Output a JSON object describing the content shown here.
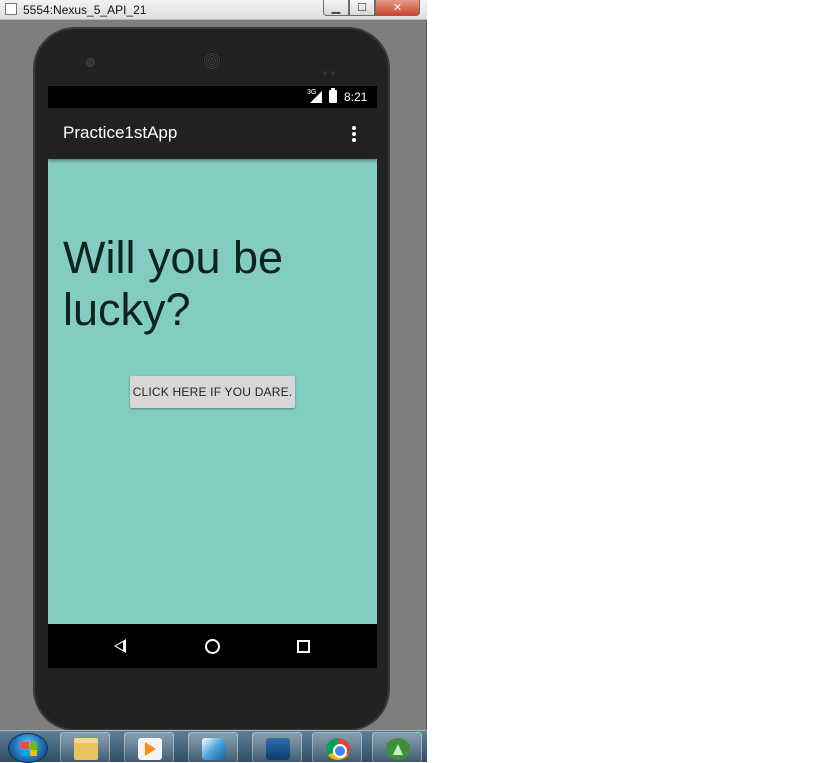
{
  "window": {
    "title": "5554:Nexus_5_API_21",
    "minimize_glyph": "▁",
    "maximize_glyph": "☐",
    "close_glyph": "✕"
  },
  "statusbar": {
    "network": "3G",
    "time": "8:21"
  },
  "actionbar": {
    "title": "Practice1stApp",
    "overflow_icon": "more-vert-icon"
  },
  "content": {
    "headline": "Will you be lucky?",
    "button_label": "CLICK HERE IF YOU DARE.",
    "background": "#82ccc2"
  },
  "navbar": {
    "icons": [
      "back-icon",
      "home-icon",
      "recents-icon"
    ]
  },
  "taskbar": {
    "items": [
      "start-button",
      "file-explorer-icon",
      "media-player-icon",
      "wifi-manager-icon",
      "4g-wimax-icon",
      "chrome-icon",
      "android-studio-icon"
    ]
  }
}
